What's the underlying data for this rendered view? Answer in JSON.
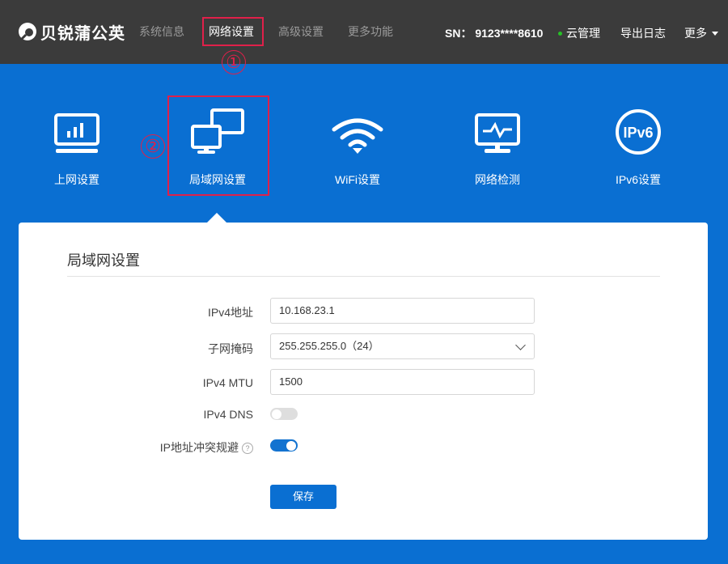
{
  "brand": {
    "name": "贝锐蒲公英"
  },
  "nav": [
    "系统信息",
    "网络设置",
    "高级设置",
    "更多功能"
  ],
  "annotations": {
    "marker1": "①",
    "marker2": "②"
  },
  "header": {
    "sn_label": "SN：",
    "sn_value": "9123****8610",
    "cloud": "云管理",
    "export_log": "导出日志",
    "more": "更多"
  },
  "functions": [
    "上网设置",
    "局域网设置",
    "WiFi设置",
    "网络检测",
    "IPv6设置"
  ],
  "ipv6_icon_text": "IPv6",
  "card": {
    "title": "局域网设置",
    "fields": {
      "ipv4_label": "IPv4地址",
      "ipv4_value": "10.168.23.1",
      "mask_label": "子网掩码",
      "mask_value": "255.255.255.0（24）",
      "mtu_label": "IPv4 MTU",
      "mtu_value": "1500",
      "dns_label": "IPv4 DNS",
      "dns_on": false,
      "conflict_label": "IP地址冲突规避",
      "conflict_on": true,
      "help_glyph": "?"
    },
    "save_label": "保存"
  },
  "colors": {
    "topbar": "#3b3b3b",
    "accent": "#0a6fd2",
    "highlight": "#e0204a",
    "online": "#26c026"
  }
}
